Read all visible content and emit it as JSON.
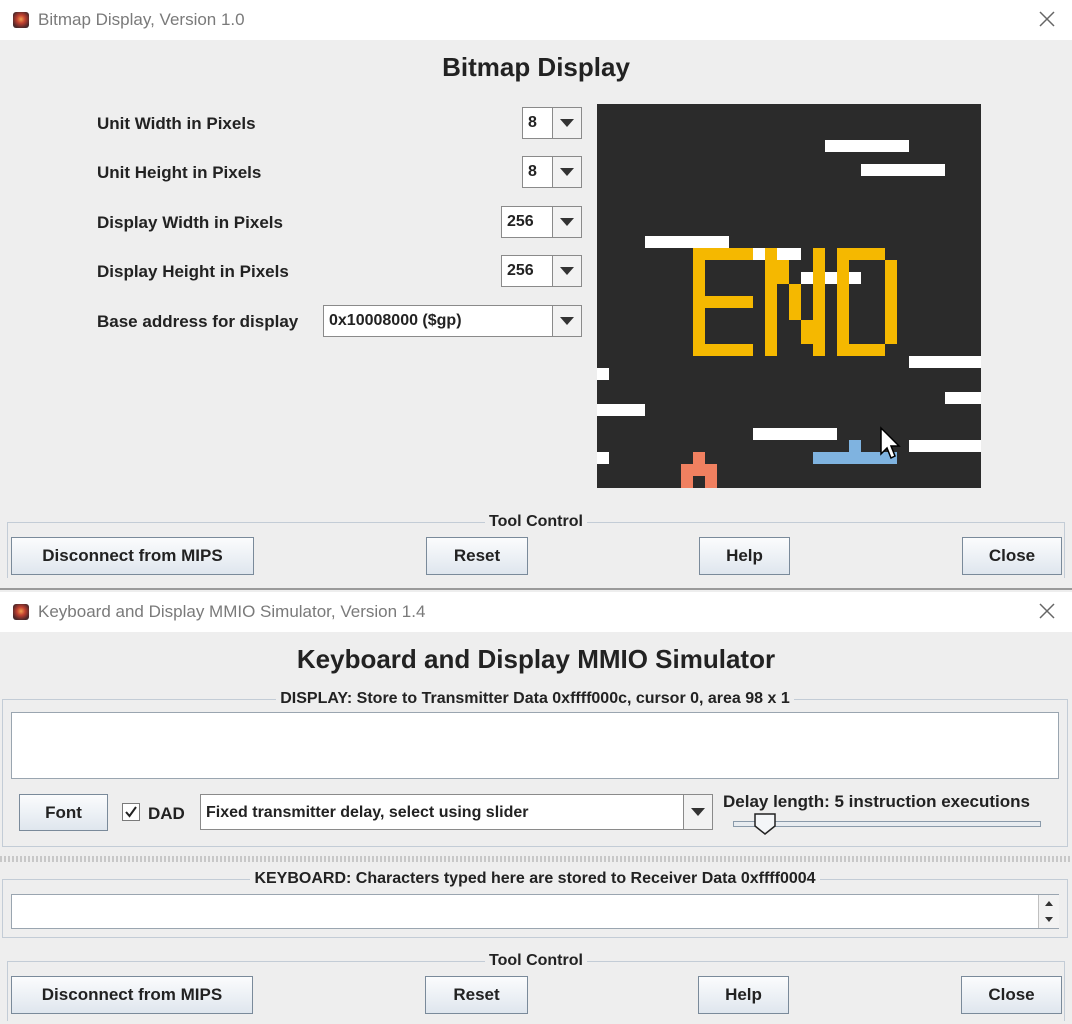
{
  "bitmap_window": {
    "title_bar": "Bitmap Display, Version 1.0",
    "heading": "Bitmap Display",
    "settings": [
      {
        "label": "Unit Width in Pixels",
        "value": "8"
      },
      {
        "label": "Unit Height in Pixels",
        "value": "8"
      },
      {
        "label": "Display Width in Pixels",
        "value": "256"
      },
      {
        "label": "Display Height in Pixels",
        "value": "256"
      },
      {
        "label": "Base address for display",
        "value": "0x10008000 ($gp)"
      }
    ],
    "display": {
      "background": "#2b2b2b",
      "text": "END",
      "text_color": "#f5b800",
      "bar_color": "#ffffff",
      "player_color": "#7fb3e0",
      "enemy_color": "#f08060"
    },
    "tool_control": {
      "title": "Tool Control",
      "disconnect": "Disconnect from MIPS",
      "reset": "Reset",
      "help": "Help",
      "close": "Close"
    }
  },
  "mmio_window": {
    "title_bar": "Keyboard and Display MMIO Simulator, Version 1.4",
    "heading": "Keyboard and Display MMIO Simulator",
    "display_group": {
      "title": "DISPLAY: Store to Transmitter Data 0xffff000c, cursor 0, area 98 x 1",
      "text": "",
      "font_button": "Font",
      "dad_checked": true,
      "dad_label": "DAD",
      "delay_mode": "Fixed transmitter delay, select using slider",
      "delay_label": "Delay length: 5 instruction executions",
      "slider_value": 5
    },
    "keyboard_group": {
      "title": "KEYBOARD: Characters typed here are stored to Receiver Data 0xffff0004",
      "text": ""
    },
    "tool_control": {
      "title": "Tool Control",
      "disconnect": "Disconnect from MIPS",
      "reset": "Reset",
      "help": "Help",
      "close": "Close"
    }
  }
}
